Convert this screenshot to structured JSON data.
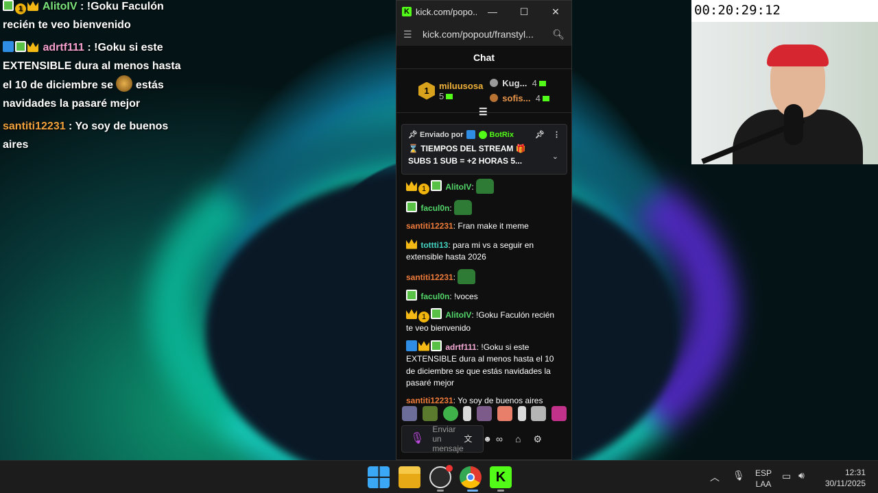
{
  "overlay_chat": [
    {
      "user": "AlitoIV",
      "text": " : !Goku Faculón recién te veo bienvenido",
      "badges": [
        "creeper",
        "gold-1",
        "crown"
      ],
      "color": "green"
    },
    {
      "user": "adrtf111",
      "text": " : !Goku si este EXTENSIBLE dura al menos hasta el 10 de diciembre se ",
      "text2": " estás navidades la pasaré mejor",
      "badges": [
        "pickaxe",
        "creeper",
        "crown"
      ],
      "color": "pink"
    },
    {
      "user": "santiti12231",
      "text": " : Yo soy de buenos aires",
      "badges": [],
      "color": "orange"
    }
  ],
  "popout": {
    "tab_title": "kick.com/popo...",
    "url": "kick.com/popout/franstyl...",
    "chat_header": "Chat",
    "leaderboard": {
      "first": {
        "rank": "1",
        "name": "miluusosa",
        "count": "5"
      },
      "second": {
        "name": "Kug...",
        "count": "4"
      },
      "third": {
        "name": "sofis...",
        "count": "4"
      }
    },
    "pinned": {
      "sent_by": "Enviado por",
      "author": "BotRix",
      "text": "⌛ TIEMPOS DEL STREAM 🎁 SUBS 1 SUB = +2 HORAS 5..."
    },
    "messages": [
      {
        "user": "AlitoIV",
        "text": ":",
        "color": "green",
        "emote": true,
        "badges": [
          "crown",
          "gold",
          "creeper"
        ]
      },
      {
        "user": "facul0n",
        "text": ":",
        "color": "green",
        "emote": true,
        "badges": [
          "creeper"
        ]
      },
      {
        "user": "santiti12231",
        "text": ": Fran make it meme",
        "color": "orange",
        "badges": []
      },
      {
        "user": "tottti13",
        "text": ": para mi vs a seguir en extensible hasta 2026",
        "color": "teal",
        "badges": [
          "crown"
        ]
      },
      {
        "user": "santiti12231",
        "text": ":",
        "color": "orange",
        "emote": true,
        "badges": []
      },
      {
        "user": "facul0n",
        "text": ": !voces",
        "color": "green",
        "badges": [
          "creeper"
        ]
      },
      {
        "user": "AlitoIV",
        "text": ": !Goku Faculón recién te veo bienvenido",
        "color": "green",
        "badges": [
          "crown",
          "gold",
          "creeper"
        ]
      },
      {
        "user": "adrtf111",
        "text": ": !Goku si este EXTENSIBLE dura al menos hasta el 10 de diciembre se que estás navidades la pasaré mejor",
        "color": "pink",
        "badges": [
          "pickaxe",
          "crown",
          "creeper"
        ]
      },
      {
        "user": "santiti12231",
        "text": ": Yo soy de buenos aires",
        "color": "orange",
        "badges": []
      }
    ],
    "input_placeholder": "Enviar un mensaje"
  },
  "timer": "00:20:29:12",
  "taskbar": {
    "language": "ESP",
    "layout": "LAA",
    "time": "12:31",
    "date": "30/11/2025"
  },
  "colors": {
    "kick_green": "#53fc18",
    "accent_orange": "#f07c3a"
  }
}
